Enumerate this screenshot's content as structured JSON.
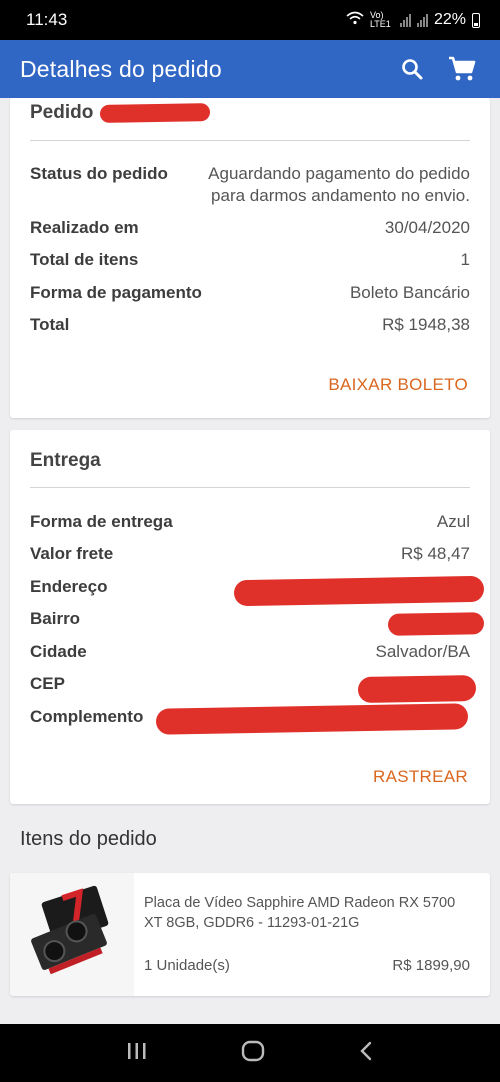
{
  "status_bar": {
    "time": "11:43",
    "network": "Vo) LTE1",
    "battery": "22%"
  },
  "app_bar": {
    "title": "Detalhes do pedido"
  },
  "order_card": {
    "title": "Pedido",
    "status_label": "Status do pedido",
    "status_value": "Aguardando pagamento do pedido para darmos andamento no envio.",
    "placed_label": "Realizado em",
    "placed_value": "30/04/2020",
    "items_label": "Total de itens",
    "items_value": "1",
    "payment_label": "Forma de pagamento",
    "payment_value": "Boleto Bancário",
    "total_label": "Total",
    "total_value": "R$ 1948,38",
    "action": "BAIXAR BOLETO"
  },
  "delivery_card": {
    "title": "Entrega",
    "method_label": "Forma de entrega",
    "method_value": "Azul",
    "freight_label": "Valor frete",
    "freight_value": "R$ 48,47",
    "address_label": "Endereço",
    "district_label": "Bairro",
    "city_label": "Cidade",
    "city_value": "Salvador/BA",
    "zip_label": "CEP",
    "complement_label": "Complemento",
    "action": "RASTREAR"
  },
  "items_section": {
    "title": "Itens do pedido",
    "items": [
      {
        "name": "Placa de Vídeo Sapphire AMD Radeon RX 5700 XT 8GB, GDDR6 - 11293-01-21G",
        "quantity": "1 Unidade(s)",
        "price": "R$ 1899,90"
      }
    ]
  },
  "colors": {
    "app_bar": "#3066c4",
    "accent": "#d9671f",
    "redaction": "#e0302a"
  },
  "icons": [
    "wifi-icon",
    "signal-icon",
    "battery-icon",
    "search-icon",
    "cart-icon",
    "recent-apps-icon",
    "home-icon",
    "back-icon"
  ]
}
